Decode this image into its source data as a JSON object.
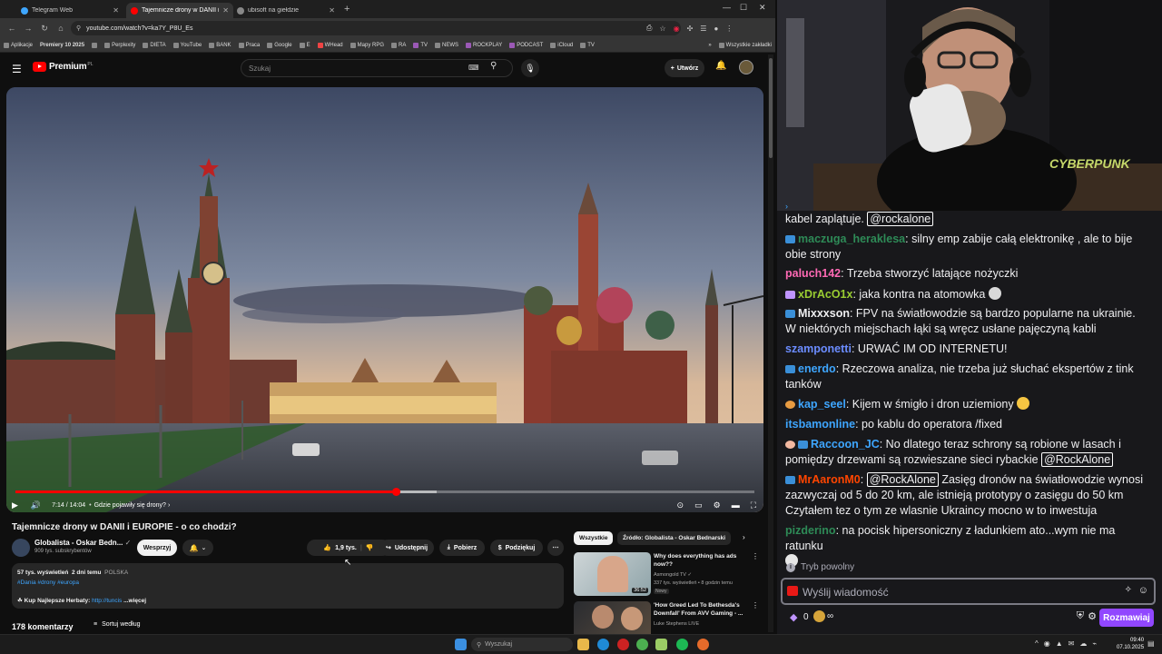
{
  "browser": {
    "tabs": [
      {
        "label": "Telegram Web",
        "color": "#3ea6ff"
      },
      {
        "label": "Tajemnicze drony w DANII i EUROPIE",
        "color": "#ff0000"
      },
      {
        "label": "ubisoft na giełdzie",
        "color": "#888888"
      }
    ],
    "new_tab": "+",
    "url": "youtube.com/watch?v=ka7Y_P8U_Es",
    "bookmarks": [
      "Aplikacje",
      "Premiery 10 2025",
      "Perplexity",
      "DIETA",
      "YouTube",
      "BANK",
      "Praca",
      "Google",
      "E",
      "WHead",
      "Mapy RPG",
      "RA",
      "TV",
      "NEWS",
      "ROCKPLAY",
      "PODCAST",
      "iCloud",
      "TV"
    ],
    "all_bookmarks": "Wszystkie zakładki"
  },
  "yt": {
    "logo": "Premium",
    "logo_sup": "PL",
    "search_placeholder": "Szukaj",
    "create": "Utwórz",
    "player": {
      "time": "7:14 / 14:04",
      "chapter": "Gdzie pojawiły się drony?",
      "progress": 0.515,
      "buffered": 0.57
    },
    "title": "Tajemnicze drony w DANII i EUROPIE - o co chodzi?",
    "channel": "Globalista - Oskar Bedn...",
    "subs": "909 tys. subskrybentów",
    "support": "Wesprzyj",
    "likes": "1,9 tys.",
    "share": "Udostępnij",
    "download": "Pobierz",
    "thanks": "Podziękuj",
    "desc": {
      "views": "57 tys. wyświetleń",
      "when": "2 dni temu",
      "country": "POLSKA",
      "tags": "#Dania #drony #europa",
      "line": "Kup Najlepsze Herbaty:",
      "link": "http://tuncis",
      "more": "...więcej"
    },
    "comments": "178 komentarzy",
    "sort": "Sortuj według",
    "chips": [
      "Wszystkie",
      "Źródło: Globalista - Oskar Bednarski"
    ],
    "recs": [
      {
        "title": "Why does everything has ads now??",
        "channel": "Asmongold TV",
        "meta": "337 tys. wyświetleń • 8 godzin temu",
        "badge": "Nowy",
        "duration": "36:52"
      },
      {
        "title": "'How Greed Led To Bethesda's Downfall' From AVV Gaming - ...",
        "channel": "Luke Stephens LIVE",
        "meta": "",
        "badge": "",
        "duration": ""
      }
    ]
  },
  "chat": {
    "messages": [
      {
        "user": "",
        "color": "#efeff1",
        "text": "kabel zaplątuje.",
        "mention": "@rockalone",
        "badge": ""
      },
      {
        "user": "maczuga_heraklesa",
        "color": "#2e8b57",
        "text": ": silny emp zabije całą elektronikę , ale to bije obie strony",
        "badge": "b"
      },
      {
        "user": "paluch142",
        "color": "#ff69b4",
        "text": ": Trzeba stworzyć latające nożyczki",
        "badge": ""
      },
      {
        "user": "xDrAcO1x",
        "color": "#9acd32",
        "text": ": jaka kontra na atomowka",
        "badge": "p"
      },
      {
        "user": "Mixxxson",
        "color": "#efeff1",
        "text": ": FPV na światłowodzie są bardzo popularne na ukrainie. W niektórych miejschach łąki są wręcz usłane pajęczyną kabli",
        "badge": "b"
      },
      {
        "user": "szamponetti",
        "color": "#6b8cff",
        "text": ": URWAĆ IM OD INTERNETU!",
        "badge": ""
      },
      {
        "user": "enerdo",
        "color": "#3ea6ff",
        "text": ": Rzeczowa analiza, nie trzeba już słuchać ekspertów z tink tanków",
        "badge": "b"
      },
      {
        "user": "kap_seel",
        "color": "#3ea6ff",
        "text": ": Kijem w śmigło i dron uziemiony",
        "badge": "o"
      },
      {
        "user": "itsbamonline",
        "color": "#3ea6ff",
        "text": ": po kablu do operatora /fixed",
        "badge": ""
      },
      {
        "user": "Raccoon_JC",
        "color": "#3ea6ff",
        "text": ": No dlatego teraz schrony są robione w lasach i pomiędzy drzewami są rozwieszane sieci rybackie",
        "mention": "@RockAlone",
        "badge": "r"
      },
      {
        "user": "MrAaronM0",
        "color": "#ff4500",
        "pre": "@RockAlone",
        "text": " Zasięg dronów na światłowodzie wynosi zazwyczaj od 5 do 20 km, ale istnieją prototypy o zasięgu do 50 km Czytałem tez o tym ze wlasnie Ukraincy mocno w to inwestuja",
        "badge": "b"
      },
      {
        "user": "pizderino",
        "color": "#2e8b57",
        "text": ": na pocisk hipersoniczny z ładunkiem ato...wym nie ma ratunku",
        "badge": ""
      }
    ],
    "slow_mode": "Tryb powolny",
    "input_placeholder": "Wyślij wiadomość",
    "points": "0",
    "infinity": "∞",
    "chat_button": "Rozmawiaj"
  },
  "taskbar": {
    "search": "Wyszukaj",
    "time": "09:40",
    "date": "07.10.2025"
  }
}
